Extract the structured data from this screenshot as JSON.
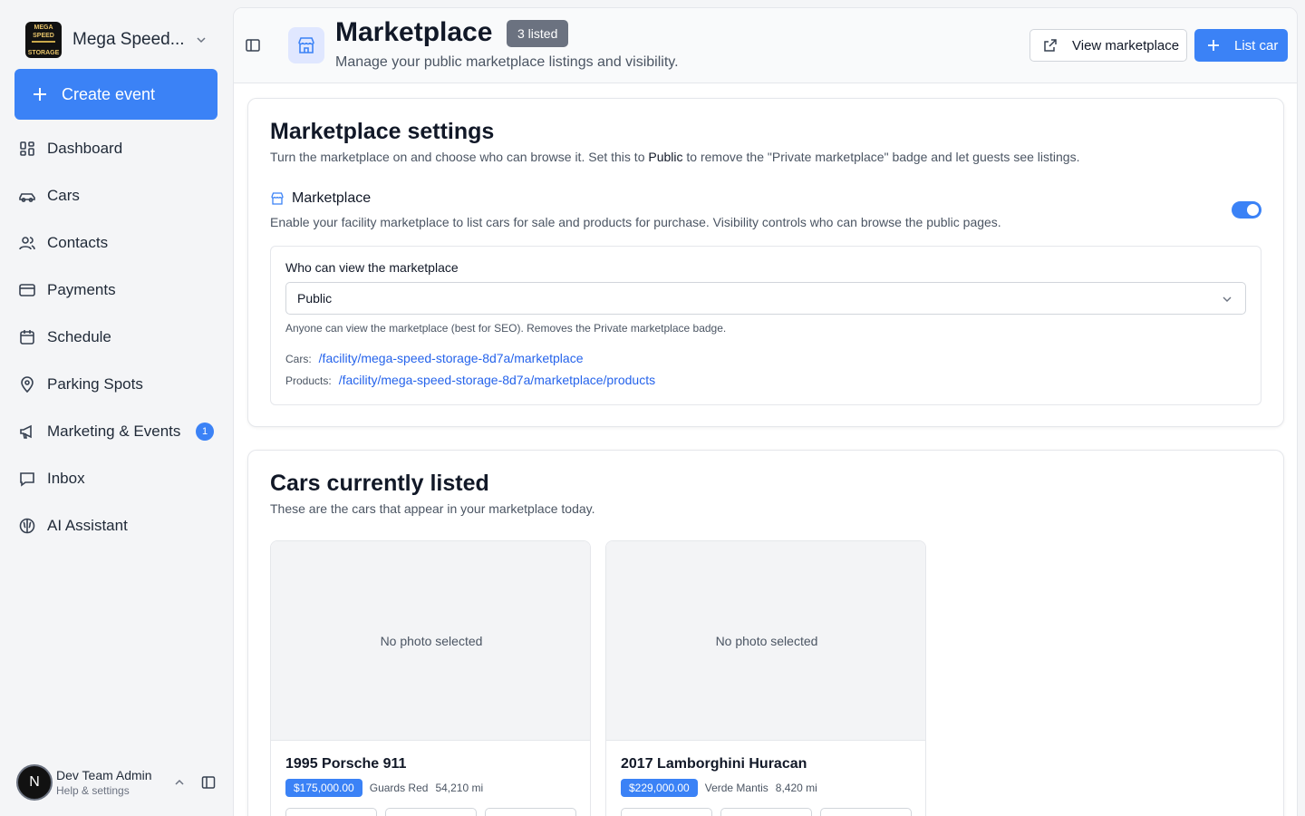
{
  "org": {
    "name": "Mega Speed...",
    "logo_top": "MEGA SPEED",
    "logo_bottom": "STORAGE"
  },
  "sidebar": {
    "create_label": "Create event",
    "items": [
      {
        "label": "Dashboard",
        "icon": "dashboard-icon"
      },
      {
        "label": "Cars",
        "icon": "car-icon"
      },
      {
        "label": "Contacts",
        "icon": "contacts-icon"
      },
      {
        "label": "Payments",
        "icon": "credit-card-icon"
      },
      {
        "label": "Schedule",
        "icon": "calendar-icon"
      },
      {
        "label": "Parking Spots",
        "icon": "map-pin-icon"
      },
      {
        "label": "Marketing & Events",
        "icon": "megaphone-icon",
        "badge": "1"
      },
      {
        "label": "Inbox",
        "icon": "inbox-icon"
      },
      {
        "label": "AI Assistant",
        "icon": "brain-icon"
      }
    ]
  },
  "user": {
    "initial": "N",
    "name": "Dev Team Admin",
    "subtitle": "Help & settings"
  },
  "header": {
    "title": "Marketplace",
    "badge": "3 listed",
    "subtitle": "Manage your public marketplace listings and visibility.",
    "view_label": "View marketplace",
    "list_label": "List car"
  },
  "settings": {
    "title": "Marketplace settings",
    "desc_before": "Turn the marketplace on and choose who can browse it. Set this to ",
    "desc_bold": "Public",
    "desc_after": " to remove the \"Private marketplace\" badge and let guests see listings.",
    "marketplace_label": "Marketplace",
    "marketplace_desc": "Enable your facility marketplace to list cars for sale and products for purchase. Visibility controls who can browse the public pages.",
    "enabled": true,
    "visibility_label": "Who can view the marketplace",
    "visibility_value": "Public",
    "visibility_help": "Anyone can view the marketplace (best for SEO). Removes the Private marketplace badge.",
    "cars_label": "Cars:",
    "cars_link": "/facility/mega-speed-storage-8d7a/marketplace",
    "products_label": "Products:",
    "products_link": "/facility/mega-speed-storage-8d7a/marketplace/products"
  },
  "cars_section": {
    "title": "Cars currently listed",
    "desc": "These are the cars that appear in your marketplace today.",
    "cars": [
      {
        "photo": "No photo selected",
        "name": "1995 Porsche 911",
        "price": "$175,000.00",
        "color": "Guards Red",
        "mileage": "54,210 mi"
      },
      {
        "photo": "No photo selected",
        "name": "2017 Lamborghini Huracan",
        "price": "$229,000.00",
        "color": "Verde Mantis",
        "mileage": "8,420 mi"
      }
    ]
  },
  "colors": {
    "accent": "#3b82f6",
    "badge_gray": "#6b7280",
    "link": "#2563eb"
  }
}
